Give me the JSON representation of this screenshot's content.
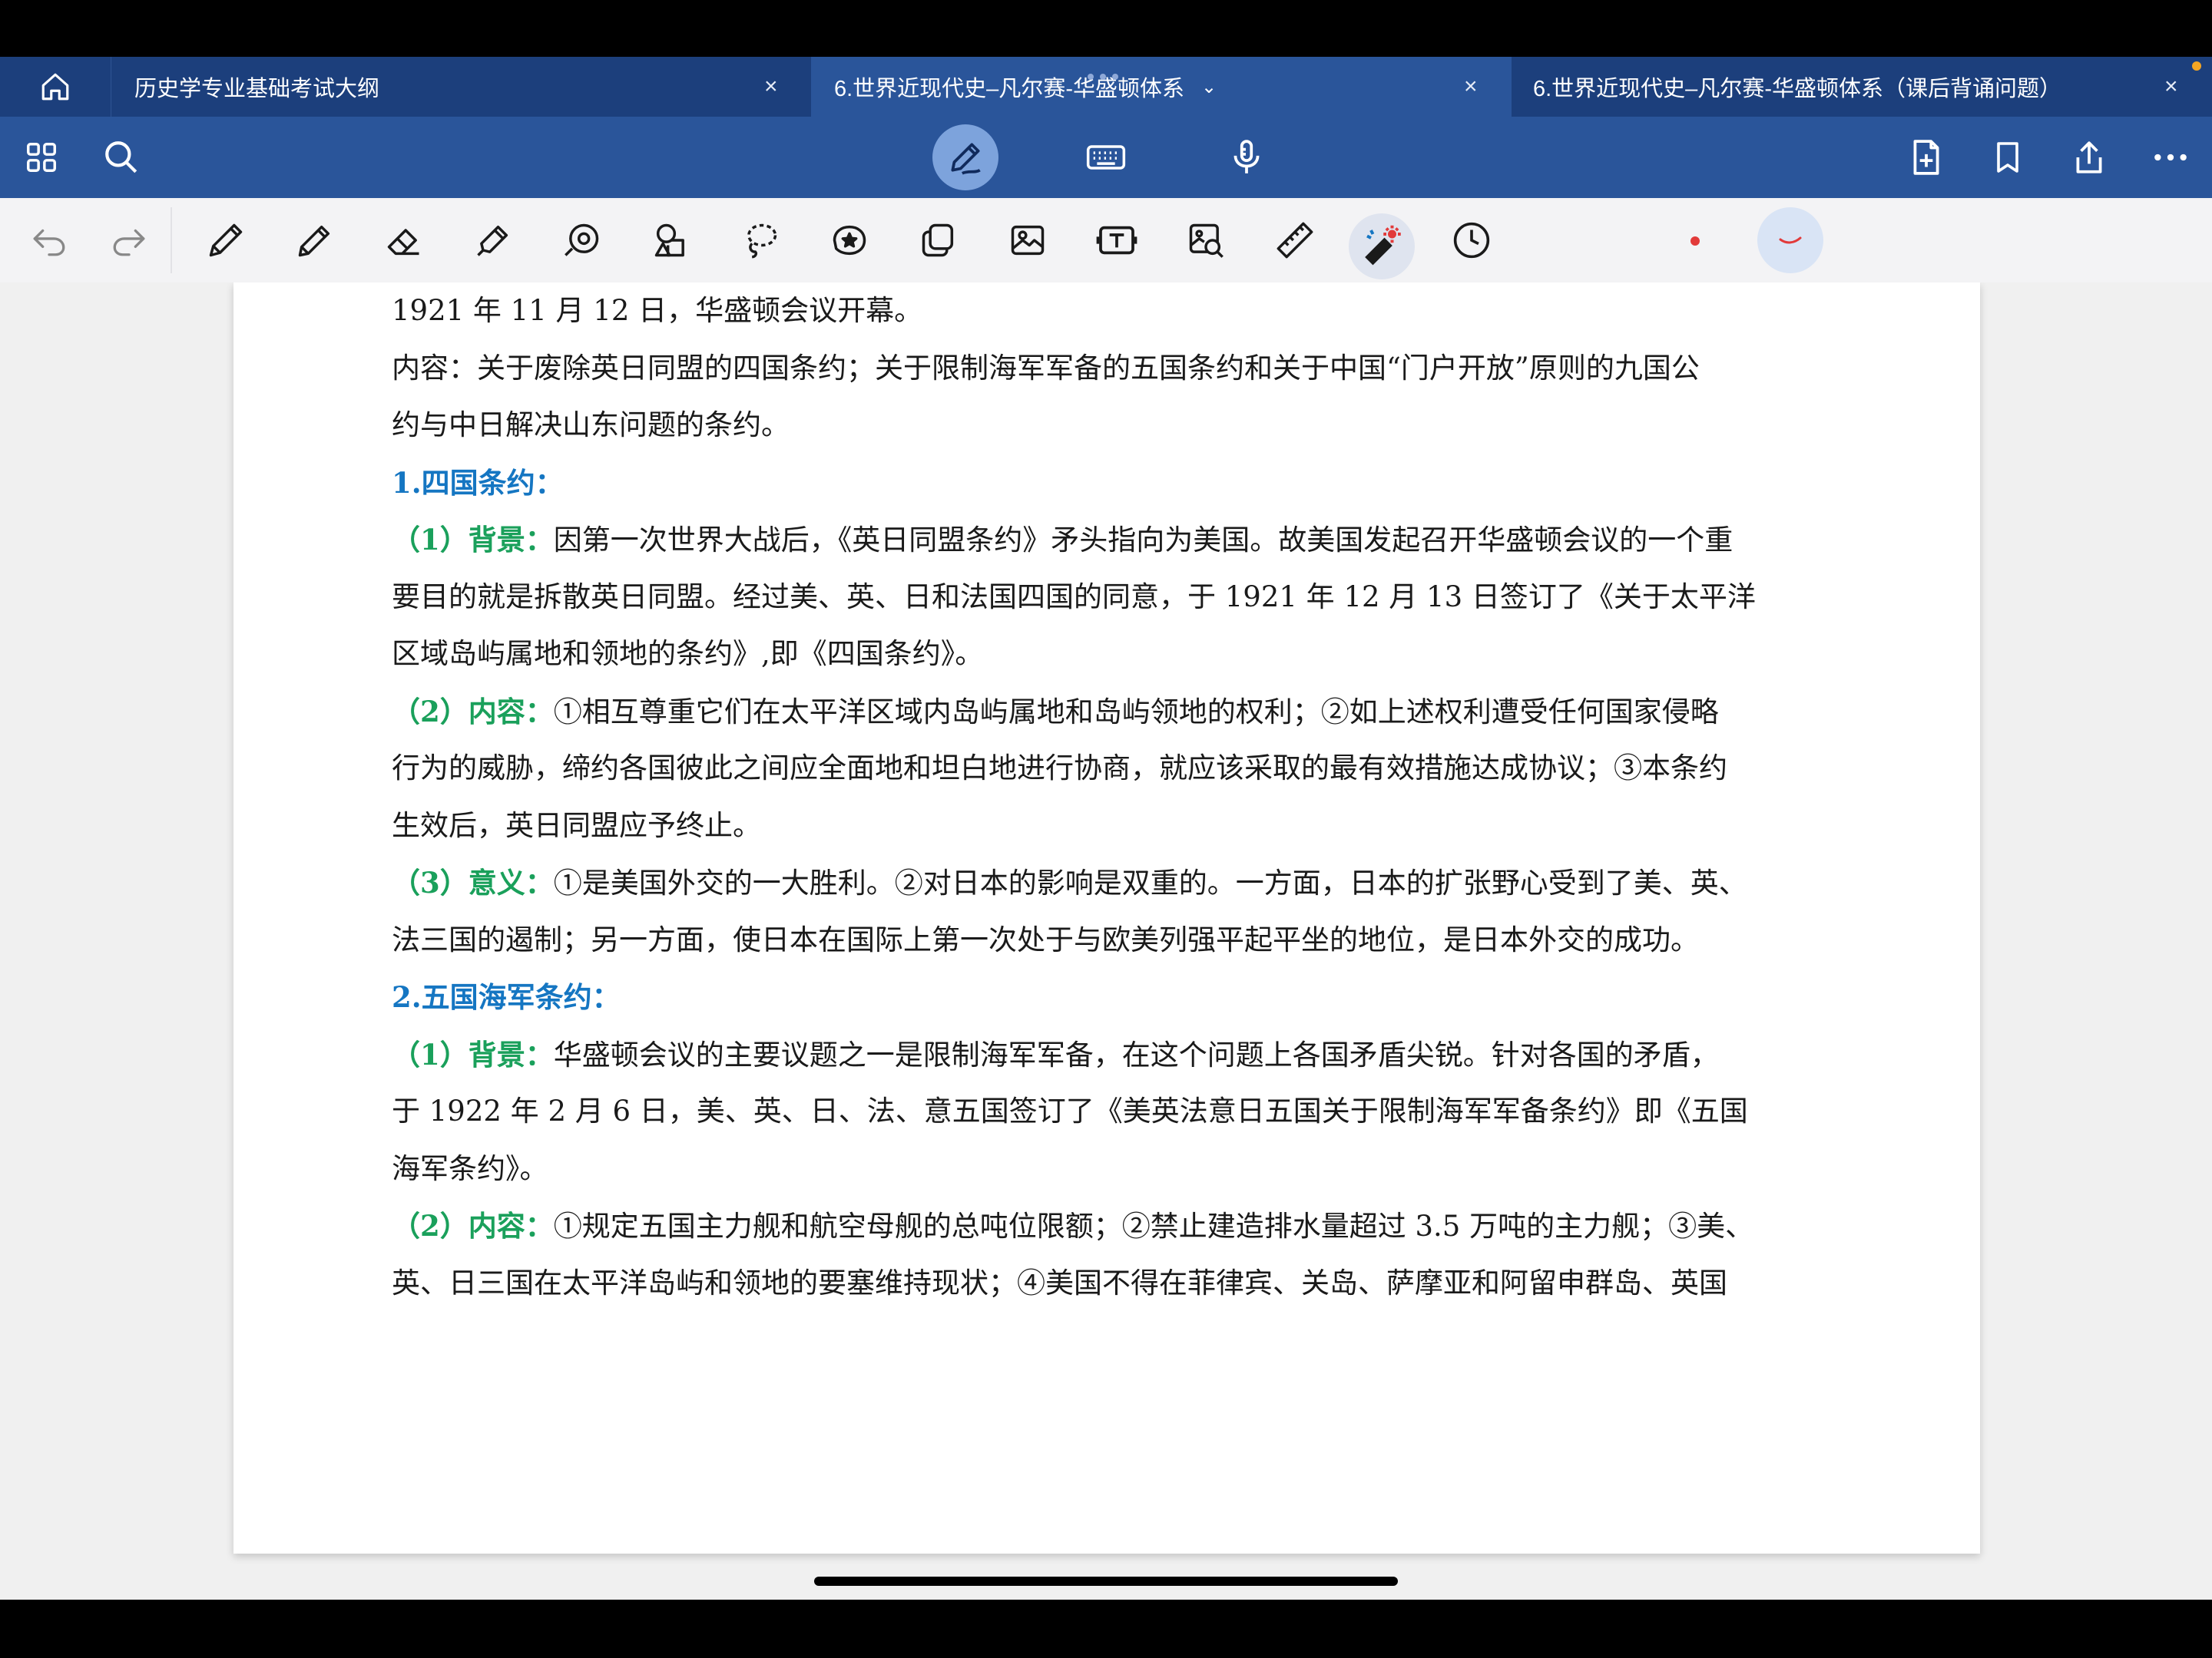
{
  "tabs": [
    {
      "title": "历史学专业基础考试大纲",
      "close": "×"
    },
    {
      "title": "6.世界近现代史–凡尔赛-华盛顿体系",
      "close": "×",
      "chevron": "⌄"
    },
    {
      "title": "6.世界近现代史–凡尔赛-华盛顿体系（课后背诵问题）",
      "close": "×"
    }
  ],
  "document": {
    "line1": "1921 年 11 月 12 日，华盛顿会议开幕。",
    "line2": "内容：关于废除英日同盟的四国条约；关于限制海军军备的五国条约和关于中国“门户开放”原则的九国公",
    "line3": "约与中日解决山东问题的条约。",
    "h1": "1.四国条约：",
    "s1_label": "（1）背景：",
    "s1_text": "因第一次世界大战后，《英日同盟条约》矛头指向为美国。故美国发起召开华盛顿会议的一个重",
    "s1_line2": "要目的就是拆散英日同盟。经过美、英、日和法国四国的同意，于 1921 年 12 月 13 日签订了《关于太平洋",
    "s1_line3": "区域岛屿属地和领地的条约》,即《四国条约》。",
    "s2_label": "（2）内容：",
    "s2_text": "①相互尊重它们在太平洋区域内岛屿属地和岛屿领地的权利；②如上述权利遭受任何国家侵略",
    "s2_line2": "行为的威胁，缔约各国彼此之间应全面地和坦白地进行协商，就应该采取的最有效措施达成协议；③本条约",
    "s2_line3": "生效后，英日同盟应予终止。",
    "s3_label": "（3）意义：",
    "s3_text": "①是美国外交的一大胜利。②对日本的影响是双重的。一方面，日本的扩张野心受到了美、英、",
    "s3_line2": "法三国的遏制；另一方面，使日本在国际上第一次处于与欧美列强平起平坐的地位，是日本外交的成功。",
    "h2": "2.五国海军条约：",
    "t1_label": "（1）背景：",
    "t1_text": "华盛顿会议的主要议题之一是限制海军军备，在这个问题上各国矛盾尖锐。针对各国的矛盾，",
    "t1_line2": "于 1922 年 2 月 6 日，美、英、日、法、意五国签订了《美英法意日五国关于限制海军军备条约》即《五国",
    "t1_line3": "海军条约》。",
    "t2_label": "（2）内容：",
    "t2_text": "①规定五国主力舰和航空母舰的总吨位限额；②禁止建造排水量超过 3.5 万吨的主力舰；③美、",
    "t2_line2": "英、日三国在太平洋岛屿和领地的要塞维持现状；④美国不得在菲律宾、关岛、萨摩亚和阿留申群岛、英国"
  }
}
